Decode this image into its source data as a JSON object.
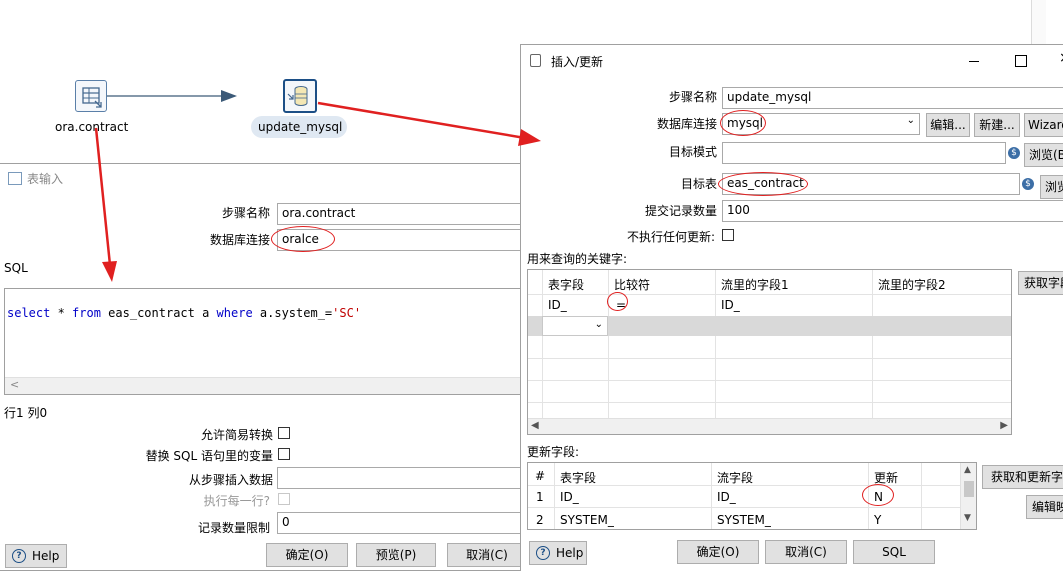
{
  "canvas": {
    "step1_label": "ora.contract",
    "step2_label": "update_mysql"
  },
  "table_input": {
    "title": "表输入",
    "step_name_label": "步骤名称",
    "step_name_value": "ora.contract",
    "db_conn_label": "数据库连接",
    "db_conn_value": "oralce",
    "sql_label": "SQL",
    "sql": {
      "kw_select": "select",
      "star": " * ",
      "kw_from": "from",
      "table": " eas_contract a ",
      "kw_where": "where",
      "cond": " a.system_=",
      "str": "'SC'"
    },
    "scroll_left": "<",
    "position": "行1 列0",
    "lazy_conv_label": "允许简易转换",
    "replace_vars_label": "替换 SQL 语句里的变量",
    "insert_from_step_label": "从步骤插入数据",
    "exec_each_row_label": "执行每一行?",
    "limit_label": "记录数量限制",
    "limit_value": "0",
    "help": "Help",
    "ok": "确定(O)",
    "preview": "预览(P)",
    "cancel": "取消(C)"
  },
  "insert_update": {
    "title": "插入/更新",
    "step_name_label": "步骤名称",
    "step_name_value": "update_mysql",
    "db_conn_label": "数据库连接",
    "db_conn_value": "mysql",
    "edit_btn": "编辑...",
    "new_btn": "新建...",
    "wizard_btn": "Wizard",
    "target_schema_label": "目标模式",
    "target_schema_value": "",
    "browse1": "浏览(B)",
    "target_table_label": "目标表",
    "target_table_value": "eas_contract",
    "browse2": "浏览",
    "commit_size_label": "提交记录数量",
    "commit_size_value": "100",
    "no_update_label": "不执行任何更新:",
    "key_section_label": "用来查询的关键字:",
    "key_headers": [
      "表字段",
      "比较符",
      "流里的字段1",
      "流里的字段2"
    ],
    "key_rows": [
      {
        "table_field": "ID_",
        "comparator": "=",
        "stream1": "ID_",
        "stream2": ""
      }
    ],
    "get_fields_btn": "获取字段",
    "update_section_label": "更新字段:",
    "update_headers": [
      "#",
      "表字段",
      "流字段",
      "更新"
    ],
    "update_rows": [
      {
        "num": "1",
        "table_field": "ID_",
        "stream_field": "ID_",
        "update": "N"
      },
      {
        "num": "2",
        "table_field": "SYSTEM_",
        "stream_field": "SYSTEM_",
        "update": "Y"
      }
    ],
    "get_update_fields_btn": "获取和更新字段",
    "edit_mapping_btn": "编辑映射",
    "help": "Help",
    "ok": "确定(O)",
    "cancel": "取消(C)",
    "sql": "SQL"
  },
  "colors": {
    "annotation_red": "#e02020",
    "sql_keyword": "#0000c8",
    "sql_string": "#c00000",
    "hop_blue": "#3c5a78"
  }
}
